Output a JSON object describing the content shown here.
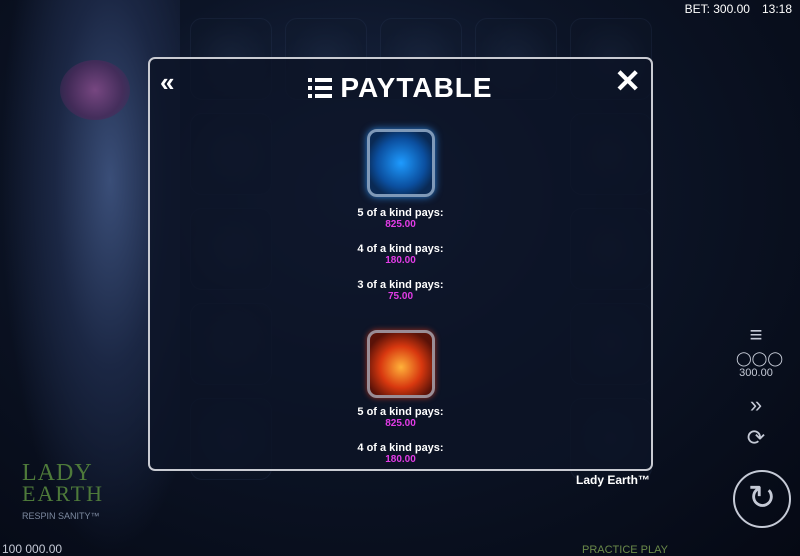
{
  "top_bar": {
    "bet": "BET: 300.00",
    "time": "13:18"
  },
  "paytable": {
    "title": "PAYTABLE",
    "symbols": [
      {
        "icon": "water-spiral-icon",
        "pays": [
          {
            "label": "5 of a kind pays:",
            "value": "825.00"
          },
          {
            "label": "4 of a kind pays:",
            "value": "180.00"
          },
          {
            "label": "3 of a kind pays:",
            "value": "75.00"
          }
        ]
      },
      {
        "icon": "fire-spiral-icon",
        "pays": [
          {
            "label": "5 of a kind pays:",
            "value": "825.00"
          },
          {
            "label": "4 of a kind pays:",
            "value": "180.00"
          }
        ]
      }
    ]
  },
  "game_name": "Lady Earth™",
  "logo": {
    "line1": "LADY",
    "line2": "EARTH",
    "line3": "RESPIN SANITY™"
  },
  "bet_display": "300.00",
  "balance": "100 000.00",
  "mode": "PRACTICE PLAY",
  "colors": {
    "accent_value": "#e23ce6",
    "panel_border": "#c9cbd2"
  }
}
